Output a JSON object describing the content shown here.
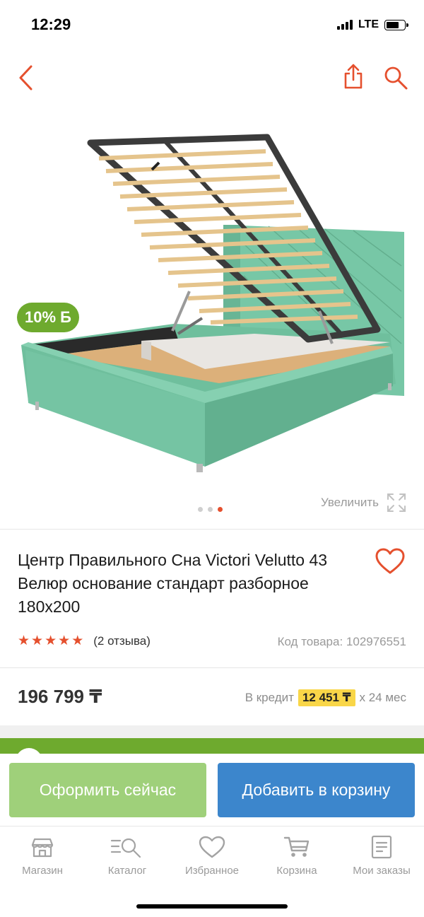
{
  "status_bar": {
    "time": "12:29",
    "network": "LTE"
  },
  "colors": {
    "accent": "#e5502e",
    "green": "#6eaa2e",
    "blue": "#3c86cc",
    "light_green": "#9fd07a",
    "credit_highlight": "#f9d648"
  },
  "gallery": {
    "discount_badge": "10% Б",
    "zoom_label": "Увеличить",
    "slides_total": 3,
    "active_slide": 3
  },
  "product": {
    "title": "Центр Правильного Сна Victori Velutto 43 Велюр основание стандарт разборное 180х200",
    "rating": 5,
    "reviews": "(2 отзыва)",
    "sku": "Код товара: 102976551",
    "price": "196 799 ₸",
    "credit_prefix": "В кредит",
    "credit_amount": "12 451 ₸",
    "credit_term": "х 24 мес"
  },
  "actions": {
    "buy_now": "Оформить сейчас",
    "add_to_cart": "Добавить в корзину"
  },
  "tabbar": [
    {
      "label": "Магазин",
      "icon": "shop-icon"
    },
    {
      "label": "Каталог",
      "icon": "catalog-icon"
    },
    {
      "label": "Избранное",
      "icon": "heart-icon"
    },
    {
      "label": "Корзина",
      "icon": "cart-icon"
    },
    {
      "label": "Мои заказы",
      "icon": "orders-icon"
    }
  ]
}
